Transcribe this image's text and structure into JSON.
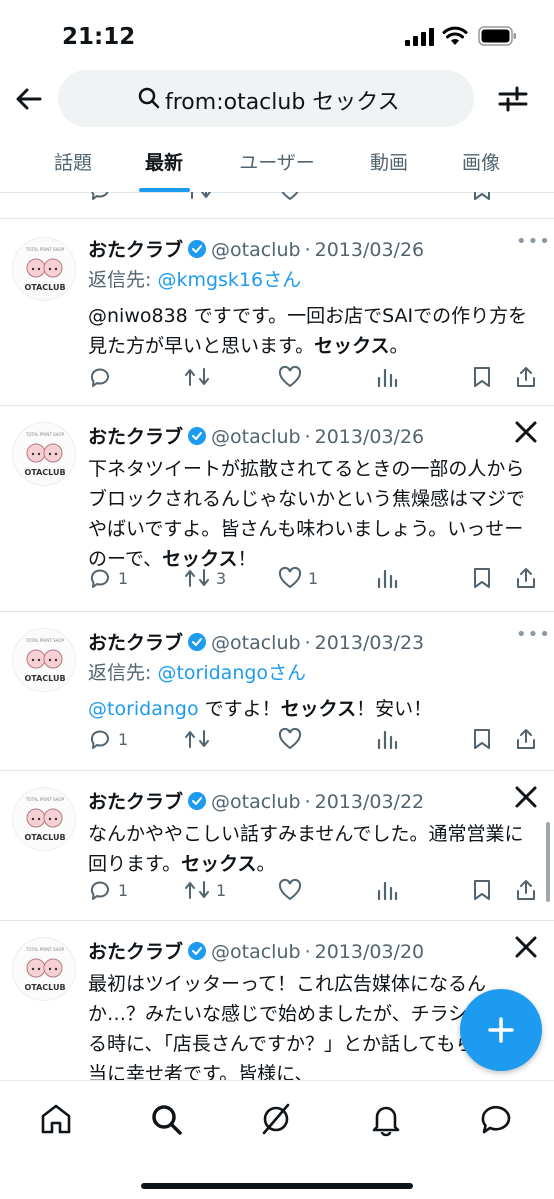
{
  "status": {
    "time": "21:12"
  },
  "search": {
    "query": "from:otaclub セックス"
  },
  "tabs": [
    "話題",
    "最新",
    "ユーザー",
    "動画",
    "画像"
  ],
  "active_tab": "最新",
  "avatar_text": {
    "top": "TOTAL PRINT SHOP",
    "bottom": "OTACLUB"
  },
  "tweets": [
    {
      "name": "おたクラブ",
      "handle": "@otaclub",
      "sep": "·",
      "date": "2013/03/26",
      "reply_prefix": "返信先: ",
      "reply_to": "@kmgsk16さん",
      "text": "@niwo838 ですです。一回お店でSAIでの作り方を見た方が早いと思います。",
      "bold": "セックス",
      "tail": "。",
      "counts": {
        "reply": "",
        "retweet": "",
        "like": ""
      }
    },
    {
      "name": "おたクラブ",
      "handle": "@otaclub",
      "sep": "·",
      "date": "2013/03/26",
      "text": "下ネタツイートが拡散されてるときの一部の人からブロックされるんじゃないかという焦燥感はマジでやばいですよ。皆さんも味わいましょう。いっせーのーで、",
      "bold": "セックス",
      "tail": "！",
      "counts": {
        "reply": "1",
        "retweet": "3",
        "like": "1"
      }
    },
    {
      "name": "おたクラブ",
      "handle": "@otaclub",
      "sep": "·",
      "date": "2013/03/23",
      "reply_prefix": "返信先: ",
      "reply_to": "@toridangoさん",
      "mention": "@toridango",
      "text": " ですよ！",
      "bold": "セックス",
      "tail": "！安い！",
      "counts": {
        "reply": "1",
        "retweet": "",
        "like": ""
      }
    },
    {
      "name": "おたクラブ",
      "handle": "@otaclub",
      "sep": "·",
      "date": "2013/03/22",
      "text": "なんかややこしい話すみませんでした。通常営業に回ります。",
      "bold": "セックス",
      "tail": "。",
      "counts": {
        "reply": "1",
        "retweet": "1",
        "like": ""
      }
    },
    {
      "name": "おたクラブ",
      "handle": "@otaclub",
      "sep": "·",
      "date": "2013/03/20",
      "text": "最初はツイッターって！これ広告媒体になるんか…？みたいな感じで始めましたが、チラシをしてる時に、「店長さんですか？」とか話してもらって本当に幸せ者です。皆様に、",
      "counts": {
        "reply": "",
        "retweet": "",
        "like": ""
      }
    }
  ],
  "colors": {
    "accent": "#1d9bf0",
    "text": "#0f1419",
    "muted": "#536471"
  },
  "icons": [
    "back-arrow-icon",
    "search-icon",
    "filter-icon",
    "reply-icon",
    "retweet-icon",
    "like-icon",
    "views-icon",
    "bookmark-icon",
    "share-icon",
    "verified-icon",
    "x-logo-icon",
    "plus-icon",
    "home-icon",
    "grok-icon",
    "notifications-icon",
    "messages-icon"
  ]
}
